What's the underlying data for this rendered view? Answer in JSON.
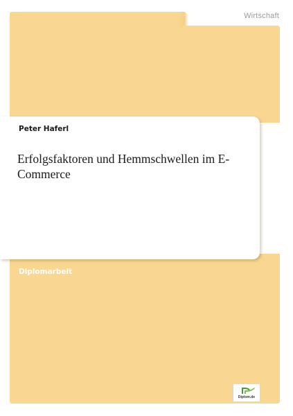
{
  "cover": {
    "category": "Wirtschaft",
    "author": "Peter Haferl",
    "title": "Erfolgsfaktoren und Hemmschwellen im E-Commerce",
    "document_type": "Diplomarbeit",
    "publisher": "Diplom.de"
  },
  "colors": {
    "panel": "#f9d790",
    "card": "#ffffff",
    "category_text": "#9a9a9a",
    "doc_type_text": "#ffffff",
    "logo_green": "#4a9a2e"
  },
  "icons": {
    "publisher_logo": "diplom-logo-icon"
  }
}
